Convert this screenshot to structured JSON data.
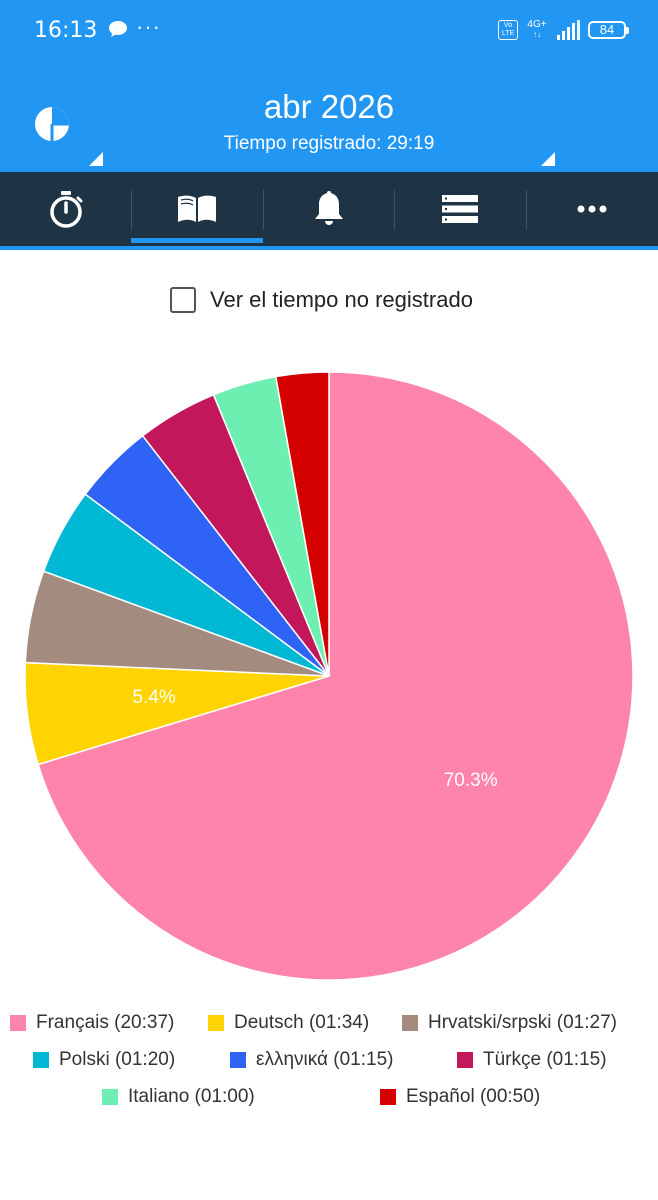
{
  "status_bar": {
    "time": "16:13",
    "volte": "Vo LTE",
    "network": "4G+",
    "battery": "84",
    "icons": [
      "chat-bubble-icon",
      "more-dots-icon",
      "volte-icon",
      "network-icon",
      "signal-icon",
      "battery-icon"
    ]
  },
  "header": {
    "title": "abr 2026",
    "subtitle": "Tiempo registrado: 29:19",
    "icon": "pie-chart-icon"
  },
  "tabs": [
    {
      "icon": "stopwatch-icon",
      "active": false
    },
    {
      "icon": "book-icon",
      "active": true
    },
    {
      "icon": "bell-icon",
      "active": false
    },
    {
      "icon": "list-icon",
      "active": false
    },
    {
      "icon": "more-icon",
      "active": false
    }
  ],
  "toggle": {
    "label": "Ver el tiempo no registrado",
    "checked": false
  },
  "chart_data": {
    "type": "pie",
    "slices": [
      {
        "label": "Français",
        "duration": "20:37",
        "value": 70.3,
        "color": "#ff84ab",
        "data_label": "70.3%"
      },
      {
        "label": "Deutsch",
        "duration": "01:34",
        "value": 5.4,
        "color": "#ffd400",
        "data_label": "5.4%"
      },
      {
        "label": "Hrvatski/srpski",
        "duration": "01:27",
        "value": 4.9,
        "color": "#a38b80",
        "data_label": ""
      },
      {
        "label": "Polski",
        "duration": "01:20",
        "value": 4.6,
        "color": "#00b8d4",
        "data_label": ""
      },
      {
        "label": "ελληνικά",
        "duration": "01:15",
        "value": 4.3,
        "color": "#2f63f5",
        "data_label": ""
      },
      {
        "label": "Türkçe",
        "duration": "01:15",
        "value": 4.3,
        "color": "#c2185b",
        "data_label": ""
      },
      {
        "label": "Italiano",
        "duration": "01:00",
        "value": 3.4,
        "color": "#6cefb0",
        "data_label": ""
      },
      {
        "label": "Español",
        "duration": "00:50",
        "value": 2.8,
        "color": "#d40000",
        "data_label": ""
      }
    ]
  },
  "legend": [
    "Français (20:37)",
    "Deutsch (01:34)",
    "Hrvatski/srpski (01:27)",
    "Polski (01:20)",
    "ελληνικά (01:15)",
    "Türkçe (01:15)",
    "Italiano (01:00)",
    "Español (00:50)"
  ],
  "colors": {
    "primary": "#2196f3",
    "tabbar": "#1e3444"
  }
}
